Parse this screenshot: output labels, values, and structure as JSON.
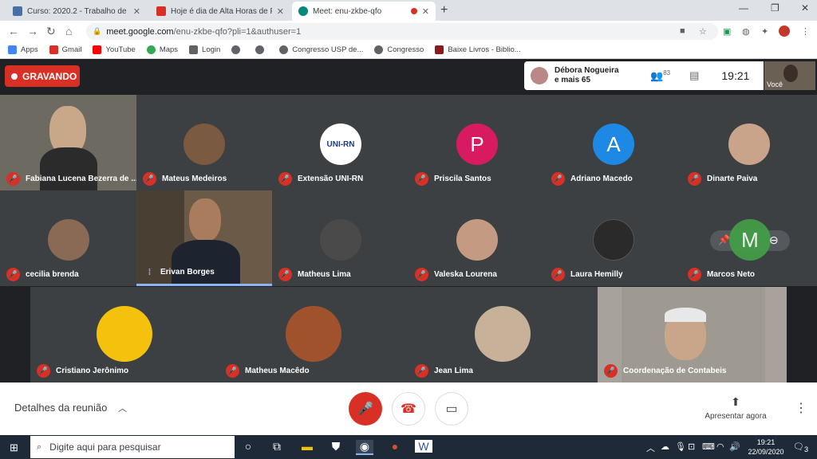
{
  "browser": {
    "tabs": [
      {
        "label": "Curso: 2020.2 - Trabalho de Conc",
        "active": false,
        "favicon_color": "#4a6fa5"
      },
      {
        "label": "Hoje é dia de Alta Horas de Papo",
        "active": false,
        "favicon_color": "#d93025"
      },
      {
        "label": "Meet: enu-zkbe-qfo",
        "active": true,
        "favicon_color": "#00897b"
      }
    ],
    "new_tab": "+",
    "window_controls": [
      "—",
      "❐",
      "✕"
    ],
    "url_host": "meet.google.com",
    "url_path": "/enu-zkbe-qfo?pli=1&authuser=1",
    "bookmarks": [
      {
        "label": "Apps",
        "icon": "apps-grid-icon",
        "color": "#4285f4"
      },
      {
        "label": "Gmail",
        "icon": "gmail-icon",
        "color": "#d93025"
      },
      {
        "label": "YouTube",
        "icon": "youtube-icon",
        "color": "#ff0000"
      },
      {
        "label": "Maps",
        "icon": "maps-pin-icon",
        "color": "#34a853"
      },
      {
        "label": "Login",
        "icon": "login-icon",
        "color": "#5f6368"
      },
      {
        "label": "",
        "icon": "globe-icon",
        "color": "#5f6368"
      },
      {
        "label": "",
        "icon": "globe-icon",
        "color": "#5f6368"
      },
      {
        "label": "Congresso USP de...",
        "icon": "globe-icon",
        "color": "#5f6368"
      },
      {
        "label": "Congresso",
        "icon": "globe-icon",
        "color": "#5f6368"
      },
      {
        "label": "Baixe Livros - Biblio...",
        "icon": "book-icon",
        "color": "#8b1a1a"
      }
    ]
  },
  "meet": {
    "recording_label": "GRAVANDO",
    "presenter_name_line1": "Débora Nogueira",
    "presenter_name_line2": "e mais 65",
    "participant_count": "83",
    "clock": "19:21",
    "self_label": "Você",
    "tiles": [
      {
        "name": "Fabiana Lucena Bezerra de ...",
        "kind": "video",
        "bg": "#6d6a62",
        "muted": true
      },
      {
        "name": "Mateus Medeiros",
        "kind": "photo",
        "bg": "#7a5a40",
        "muted": true
      },
      {
        "name": "Extensão UNI-RN",
        "kind": "logo",
        "bg": "#ffffff",
        "logo_text": "UNI-RN",
        "muted": true
      },
      {
        "name": "Priscila Santos",
        "kind": "letter",
        "letter": "P",
        "bg": "#d81b60",
        "muted": true
      },
      {
        "name": "Adriano Macedo",
        "kind": "letter",
        "letter": "A",
        "bg": "#1e88e5",
        "muted": true
      },
      {
        "name": "Dinarte Paiva",
        "kind": "photo",
        "bg": "#c9a48a",
        "muted": true
      },
      {
        "name": "cecilia brenda",
        "kind": "photo",
        "bg": "#8a6a55",
        "muted": true
      },
      {
        "name": "Erivan Borges",
        "kind": "video",
        "bg": "#6b5a48",
        "muted": false
      },
      {
        "name": "Matheus Lima",
        "kind": "photo",
        "bg": "#4a4a4a",
        "muted": true
      },
      {
        "name": "Valeska Lourena",
        "kind": "photo",
        "bg": "#c49a82",
        "muted": true
      },
      {
        "name": "Laura Hemilly",
        "kind": "photo",
        "bg": "#2a2a2a",
        "muted": true
      },
      {
        "name": "Marcos Neto",
        "kind": "letter",
        "letter": "M",
        "bg": "#43a047",
        "muted": true
      },
      {
        "name": "Cristiano Jerônimo",
        "kind": "photo",
        "bg": "#f4c20d",
        "muted": true
      },
      {
        "name": "Matheus Macêdo",
        "kind": "photo",
        "bg": "#a0522d",
        "muted": true
      },
      {
        "name": "Jean Lima",
        "kind": "photo",
        "bg": "#c7b299",
        "muted": true
      },
      {
        "name": "Coordenação de Contabeis",
        "kind": "video",
        "bg": "#a7a39c",
        "muted": true
      }
    ],
    "details_label": "Detalhes da reunião",
    "present_label": "Apresentar agora"
  },
  "taskbar": {
    "search_placeholder": "Digite aqui para pesquisar",
    "time": "19:21",
    "date": "22/09/2020",
    "notifications": "3"
  }
}
